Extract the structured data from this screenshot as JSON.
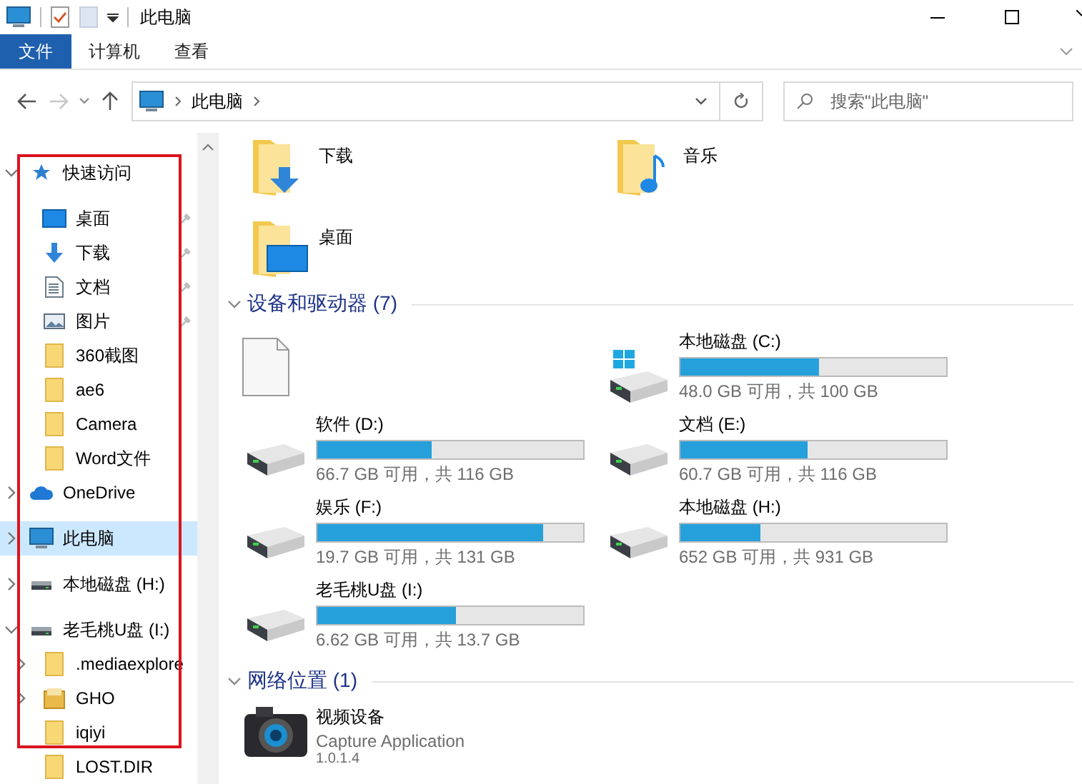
{
  "window": {
    "title": "此电脑"
  },
  "ribbon_tabs": [
    {
      "label": "文件",
      "selected": true
    },
    {
      "label": "计算机",
      "selected": false
    },
    {
      "label": "查看",
      "selected": false
    }
  ],
  "navigation": {
    "forward_disabled": true,
    "breadcrumb": [
      "此电脑"
    ]
  },
  "search": {
    "placeholder": "搜索\"此电脑\""
  },
  "sidebar": {
    "items": [
      {
        "label": "快速访问",
        "kind": "star",
        "expanded": true,
        "selected": false,
        "children": [
          {
            "label": "桌面",
            "kind": "desktop",
            "pinned": true,
            "selected": false
          },
          {
            "label": "下载",
            "kind": "download",
            "pinned": true,
            "selected": false
          },
          {
            "label": "文档",
            "kind": "document",
            "pinned": true,
            "selected": false
          },
          {
            "label": "图片",
            "kind": "picture",
            "pinned": true,
            "selected": false
          },
          {
            "label": "360截图",
            "kind": "folder",
            "pinned": false,
            "selected": false
          },
          {
            "label": "ae6",
            "kind": "folder",
            "pinned": false,
            "selected": false
          },
          {
            "label": "Camera",
            "kind": "folder",
            "pinned": false,
            "selected": false
          },
          {
            "label": "Word文件",
            "kind": "folder",
            "pinned": false,
            "selected": false
          }
        ]
      },
      {
        "label": "OneDrive",
        "kind": "cloud",
        "expanded": false,
        "selected": false
      },
      {
        "label": "此电脑",
        "kind": "computer",
        "expanded": false,
        "selected": true
      },
      {
        "label": "本地磁盘 (H:)",
        "kind": "drive",
        "expanded": false,
        "selected": false
      },
      {
        "label": "老毛桃U盘 (I:)",
        "kind": "drive",
        "expanded": true,
        "selected": false,
        "children": [
          {
            "label": ".mediaexplore",
            "kind": "folder",
            "expanded": false,
            "selected": false
          },
          {
            "label": "GHO",
            "kind": "gho",
            "expanded": false,
            "selected": false
          },
          {
            "label": "iqiyi",
            "kind": "folder",
            "selected": false
          },
          {
            "label": "LOST.DIR",
            "kind": "folder",
            "selected": false
          }
        ]
      }
    ]
  },
  "content": {
    "folders": [
      {
        "name": "下载",
        "kind": "download"
      },
      {
        "name": "音乐",
        "kind": "music"
      },
      {
        "name": "桌面",
        "kind": "desktop"
      }
    ],
    "sections": [
      {
        "title": "设备和驱动器 (7)",
        "expanded": true,
        "items": [
          {
            "kind": "unknown"
          },
          {
            "kind": "system-drive",
            "name": "本地磁盘 (C:)",
            "level": 0.52,
            "reading": "48.0 GB 可用，共 100 GB"
          },
          {
            "kind": "drive",
            "name": "软件 (D:)",
            "level": 0.43,
            "reading": "66.7 GB 可用，共 116 GB"
          },
          {
            "kind": "drive",
            "name": "文档 (E:)",
            "level": 0.48,
            "reading": "60.7 GB 可用，共 116 GB"
          },
          {
            "kind": "drive",
            "name": "娱乐 (F:)",
            "level": 0.85,
            "reading": "19.7 GB 可用，共 131 GB"
          },
          {
            "kind": "drive",
            "name": "本地磁盘 (H:)",
            "level": 0.3,
            "reading": "652 GB 可用，共 931 GB"
          },
          {
            "kind": "drive",
            "name": "老毛桃U盘 (I:)",
            "level": 0.52,
            "reading": "6.62 GB 可用，共 13.7 GB"
          }
        ]
      },
      {
        "title": "网络位置 (1)",
        "expanded": true,
        "items": [
          {
            "kind": "camera",
            "name": "视频设备",
            "subtitle": "Capture Application",
            "detail": "1.0.1.4"
          }
        ]
      }
    ]
  }
}
